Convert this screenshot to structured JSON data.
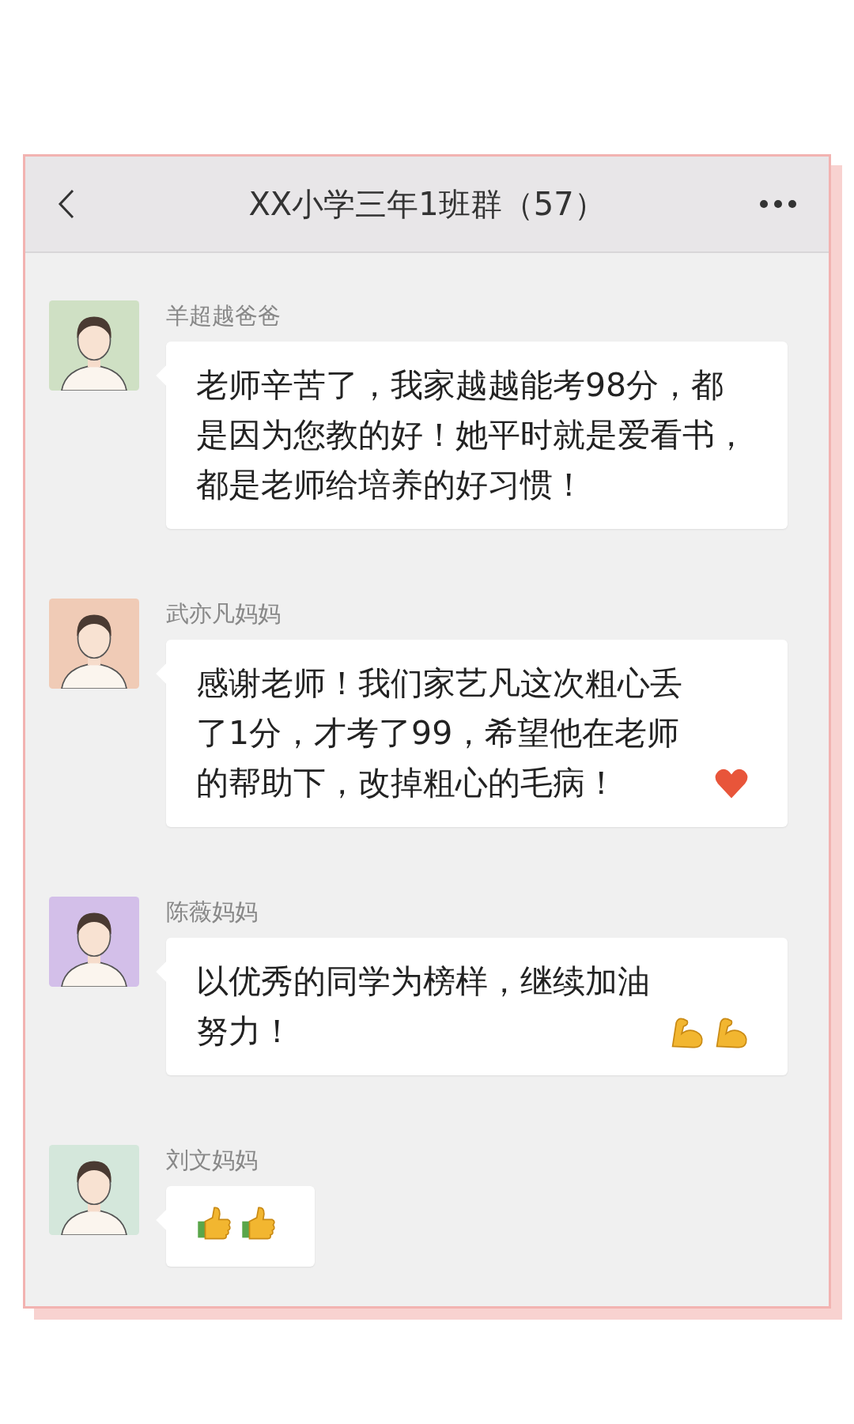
{
  "header": {
    "title": "XX小学三年1班群（57）"
  },
  "messages": [
    {
      "name": "羊超越爸爸",
      "color": "#cfe0c4",
      "text": "老师辛苦了，我家越越能考98分，都是因为您教的好！她平时就是爱看书，都是老师给培养的好习惯！"
    },
    {
      "name": "武亦凡妈妈",
      "color": "#f0cbb6",
      "text": "感谢老师！我们家艺凡这次粗心丢了1分，才考了99，希望他在老师的帮助下，改掉粗心的毛病！",
      "icons": [
        {
          "kind": "heart"
        }
      ]
    },
    {
      "name": "陈薇妈妈",
      "color": "#d3bfe9",
      "text": "以优秀的同学为榜样，继续加油努力！",
      "icons": [
        {
          "kind": "arm"
        },
        {
          "kind": "arm"
        }
      ]
    },
    {
      "name": "刘文妈妈",
      "color": "#d4e7db",
      "icons": [
        {
          "kind": "thumb"
        },
        {
          "kind": "thumb"
        }
      ]
    }
  ]
}
